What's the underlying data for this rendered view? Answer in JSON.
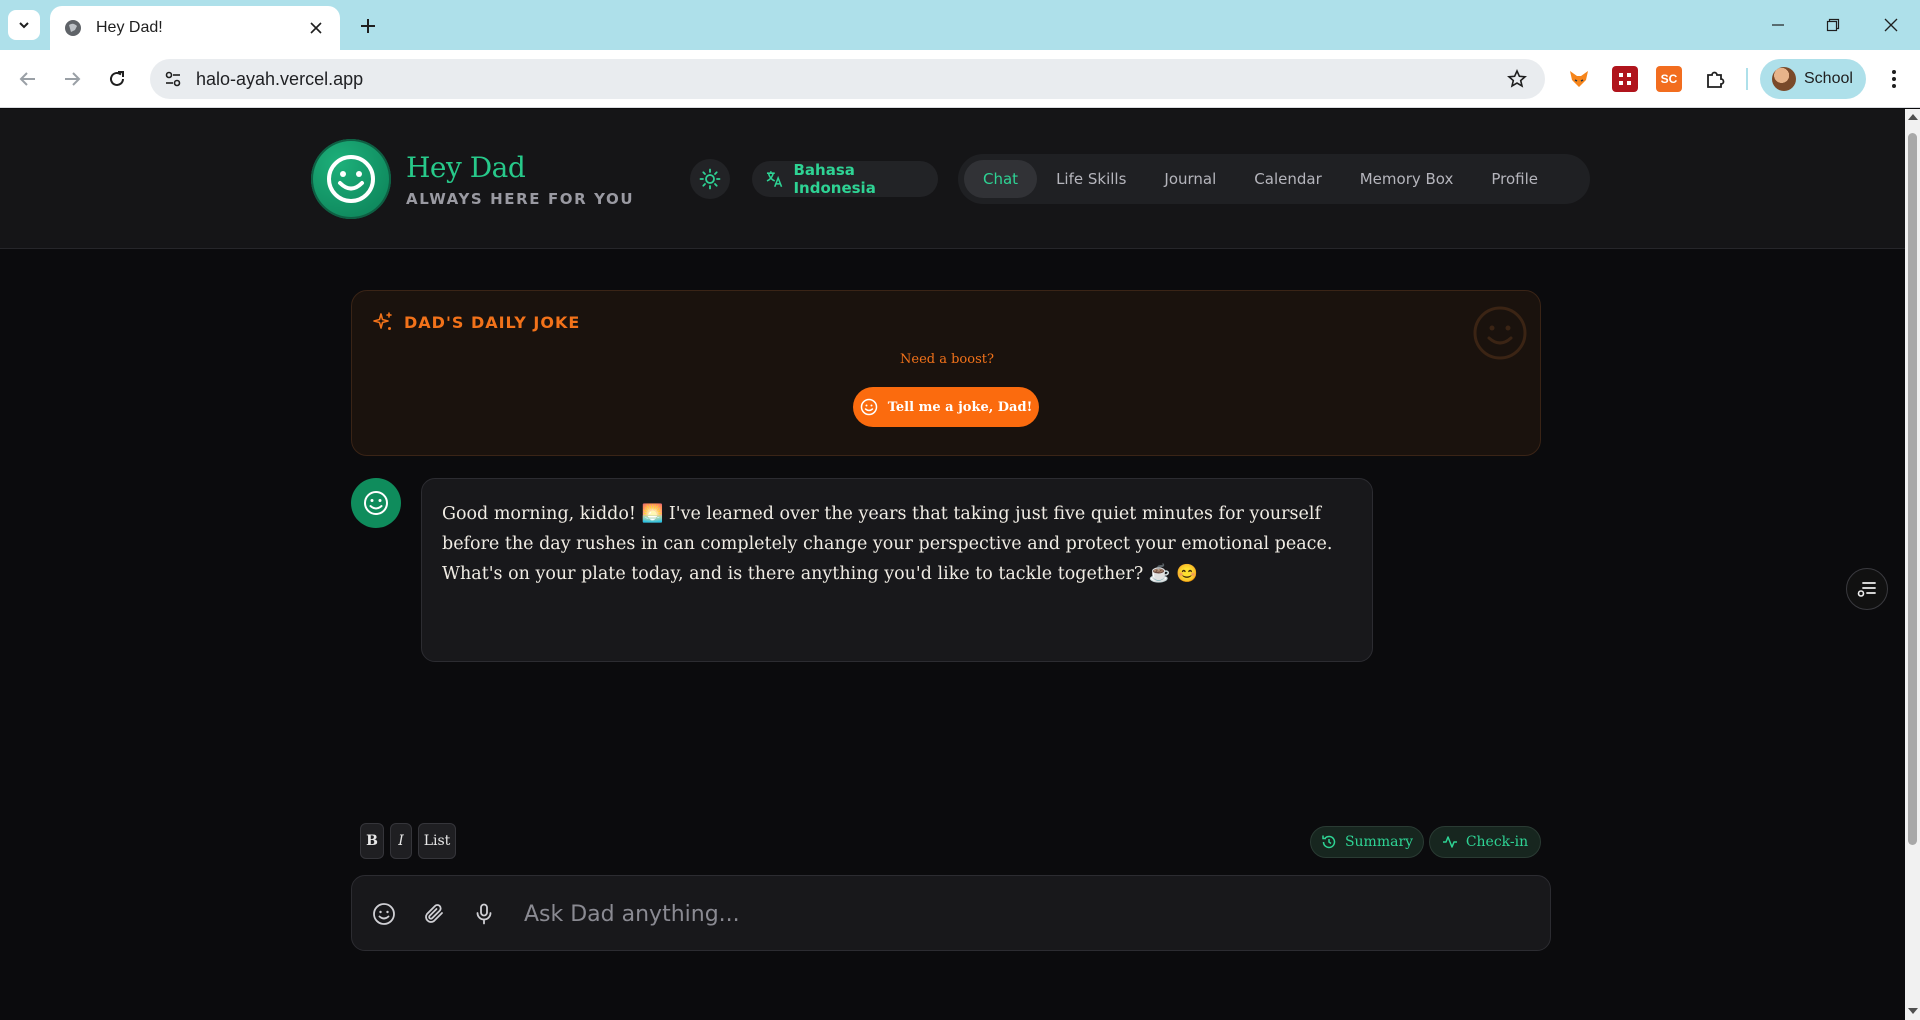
{
  "browser": {
    "tab_title": "Hey Dad!",
    "url": "halo-ayah.vercel.app",
    "profile_name": "School",
    "extensions": [
      "fox-extension-icon",
      "grid-extension-icon",
      "sc-extension-icon",
      "puzzle-icon"
    ],
    "extension_text": "SC"
  },
  "header": {
    "title": "Hey Dad",
    "subtitle": "ALWAYS HERE FOR YOU",
    "language_label": "Bahasa Indonesia",
    "nav": [
      {
        "label": "Chat",
        "active": true
      },
      {
        "label": "Life Skills",
        "active": false
      },
      {
        "label": "Journal",
        "active": false
      },
      {
        "label": "Calendar",
        "active": false
      },
      {
        "label": "Memory Box",
        "active": false
      },
      {
        "label": "Profile",
        "active": false
      }
    ]
  },
  "joke": {
    "title": "DAD'S DAILY JOKE",
    "prompt": "Need a boost?",
    "button_label": "Tell me a joke, Dad!"
  },
  "message": {
    "text": "Good morning, kiddo! 🌅 I've learned over the years that taking just five quiet minutes for yourself before the day rushes in can completely change your perspective and protect your emotional peace. What's on your plate today, and is there anything you'd like to tackle together? ☕ 😊"
  },
  "format_toolbar": {
    "bold_label": "B",
    "italic_label": "I",
    "list_label": "List"
  },
  "actions": {
    "summary_label": "Summary",
    "checkin_label": "Check-in"
  },
  "composer": {
    "placeholder": "Ask Dad anything..."
  },
  "colors": {
    "accent_green": "#2ed394",
    "accent_orange": "#fb6b0e",
    "background": "#0b0b0d",
    "chrome_tabbar": "#aee0ea"
  }
}
